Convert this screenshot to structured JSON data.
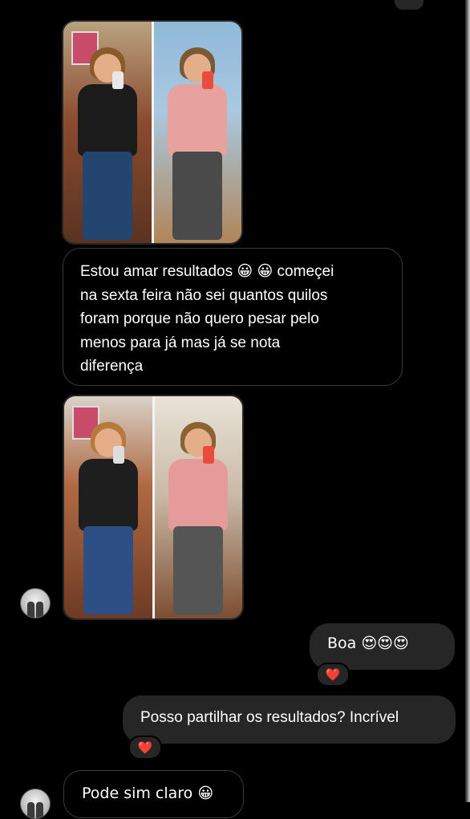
{
  "conversation": {
    "messages": [
      {
        "id": "incoming-1",
        "direction": "incoming",
        "text": "Estou amar resultados 😀😀 começei na sexta feira não sei quantos quilos foram porque não quero pesar pelo menos para já mas já se nota diferença",
        "lines": [
          "Estou amar resultados 😀 😀 começei",
          "na sexta feira não sei quantos quilos",
          "foram porque não quero pesar pelo",
          "menos para já mas já se nota",
          "diferença"
        ]
      },
      {
        "id": "outgoing-1",
        "direction": "outgoing",
        "text": "Boa 😍😍😍",
        "reaction": "❤️"
      },
      {
        "id": "outgoing-2",
        "direction": "outgoing",
        "text": "Posso partilhar os resultados? Incrível",
        "reaction": "❤️"
      },
      {
        "id": "incoming-2",
        "direction": "incoming",
        "text": "Pode sim claro 😀"
      }
    ]
  },
  "icons": {
    "reaction": "heart-icon",
    "avatar": "profile-avatar-icon"
  },
  "colors": {
    "background": "#000000",
    "outgoing_bubble": "#262626",
    "incoming_border": "#3a3a3a",
    "heart": "#e0245e"
  }
}
